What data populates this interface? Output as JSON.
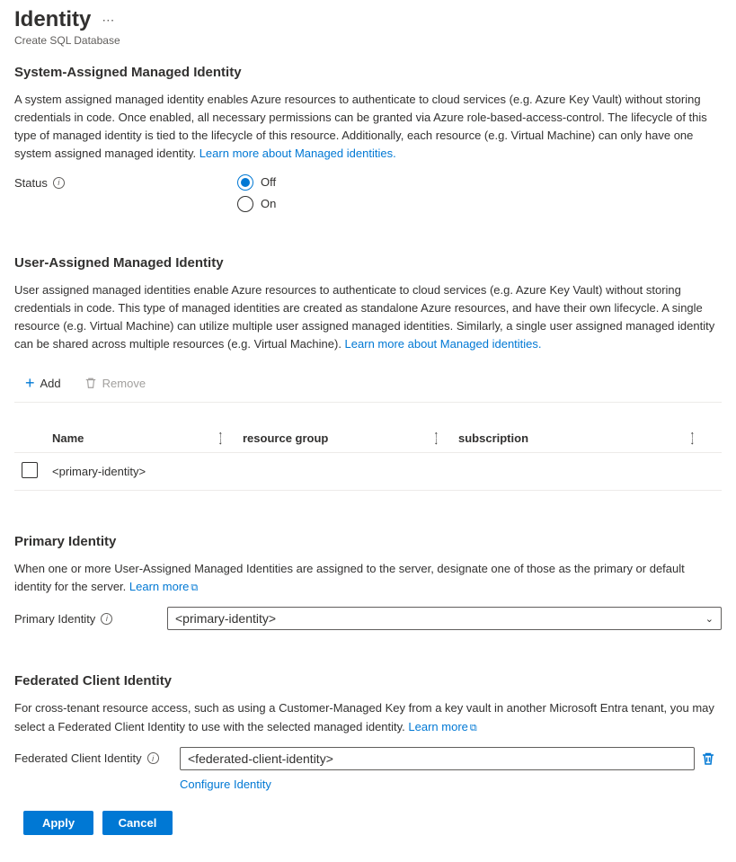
{
  "header": {
    "title": "Identity",
    "subtitle": "Create SQL Database"
  },
  "systemAssigned": {
    "heading": "System-Assigned Managed Identity",
    "description": "A system assigned managed identity enables Azure resources to authenticate to cloud services (e.g. Azure Key Vault) without storing credentials in code. Once enabled, all necessary permissions can be granted via Azure role-based-access-control. The lifecycle of this type of managed identity is tied to the lifecycle of this resource. Additionally, each resource (e.g. Virtual Machine) can only have one system assigned managed identity. ",
    "learnMore": "Learn more about Managed identities.",
    "statusLabel": "Status",
    "options": {
      "off": "Off",
      "on": "On"
    },
    "selected": "off"
  },
  "userAssigned": {
    "heading": "User-Assigned Managed Identity",
    "description": "User assigned managed identities enable Azure resources to authenticate to cloud services (e.g. Azure Key Vault) without storing credentials in code. This type of managed identities are created as standalone Azure resources, and have their own lifecycle. A single resource (e.g. Virtual Machine) can utilize multiple user assigned managed identities. Similarly, a single user assigned managed identity can be shared across multiple resources (e.g. Virtual Machine). ",
    "learnMore": "Learn more about Managed identities.",
    "toolbar": {
      "add": "Add",
      "remove": "Remove"
    },
    "table": {
      "headers": {
        "name": "Name",
        "resourceGroup": "resource group",
        "subscription": "subscription"
      },
      "rows": [
        {
          "name": "<primary-identity>"
        }
      ]
    }
  },
  "primaryIdentity": {
    "heading": "Primary Identity",
    "description": "When one or more User-Assigned Managed Identities are assigned to the server, designate one of those as the primary or default identity for the server. ",
    "learnMore": "Learn more",
    "label": "Primary Identity",
    "value": "<primary-identity>"
  },
  "federated": {
    "heading": "Federated Client Identity",
    "description": "For cross-tenant resource access, such as using a Customer-Managed Key from a key vault in another Microsoft Entra tenant, you may select a Federated Client Identity to use with the selected managed identity. ",
    "learnMore": "Learn more",
    "label": "Federated Client Identity",
    "value": "<federated-client-identity>",
    "configure": "Configure Identity"
  },
  "footer": {
    "apply": "Apply",
    "cancel": "Cancel"
  }
}
